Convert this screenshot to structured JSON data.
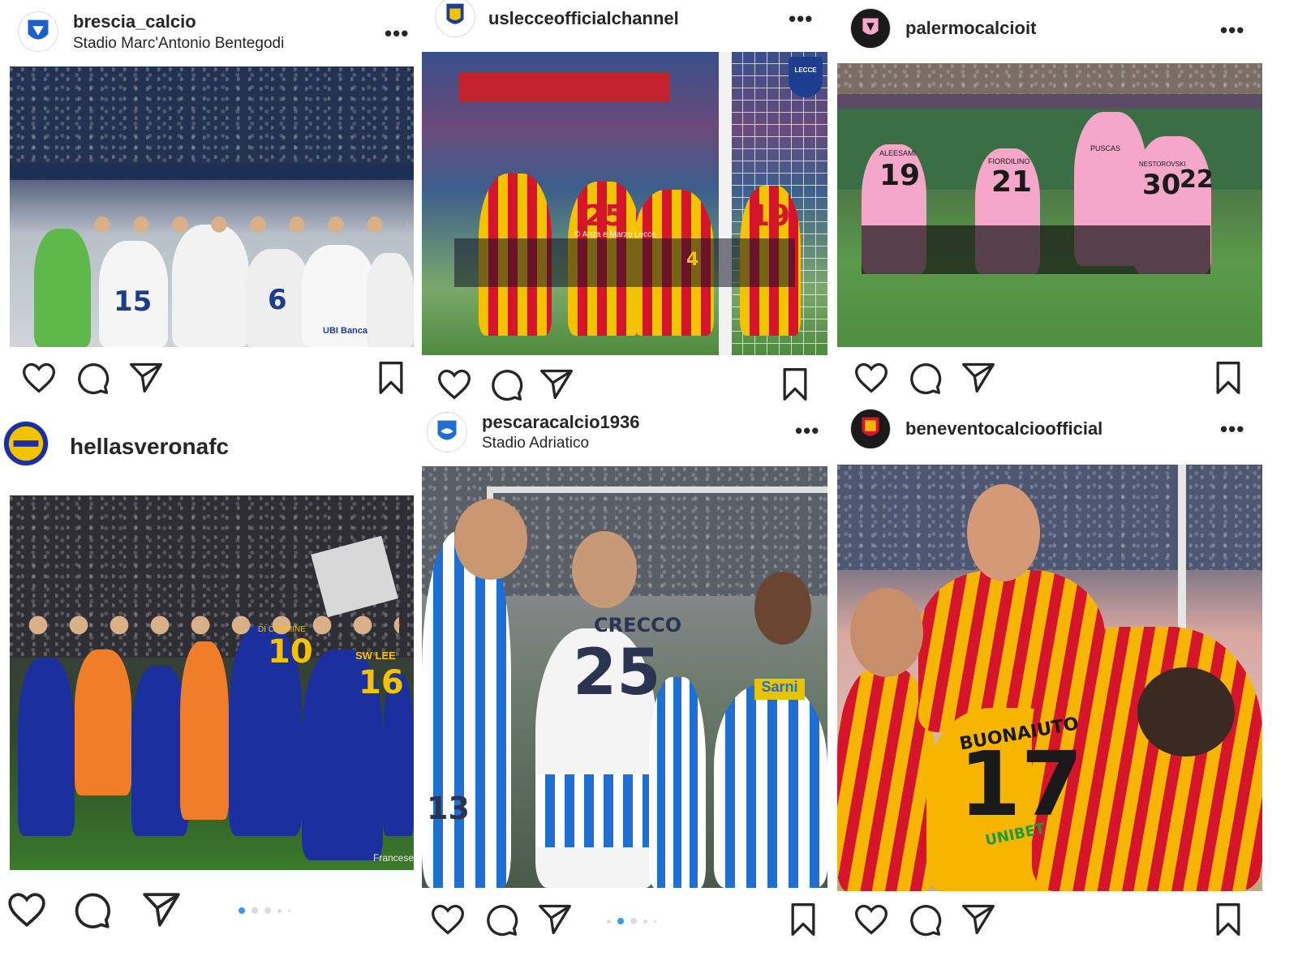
{
  "posts": [
    {
      "username": "brescia_calcio",
      "location": "Stadio Marc'Antonio Bentegodi",
      "more": "•••",
      "photo": {
        "numbers": [
          "15",
          "6"
        ],
        "sponsor": "UBI Banca"
      }
    },
    {
      "username": "uslecceofficialchannel",
      "location": "",
      "more": "•••",
      "photo": {
        "numbers": [
          "25",
          "19",
          "4"
        ],
        "watermark": "© Anza e Marzo Lecce",
        "badge": "LECCE"
      }
    },
    {
      "username": "palermocalcioit",
      "location": "",
      "more": "•••",
      "photo": {
        "numbers": [
          "19",
          "21",
          "30",
          "22"
        ],
        "names": [
          "ALEESAMI",
          "FIORDILINO",
          "PUSCAS",
          "NESTOROVSKI"
        ]
      }
    },
    {
      "username": "hellasveronafc",
      "location": "",
      "more": "",
      "photo": {
        "numbers": [
          "10",
          "16"
        ],
        "names": [
          "DI CARMINE",
          "SW LEE"
        ],
        "watermark": "Francese"
      },
      "carousel": {
        "count": 5,
        "active": 0
      }
    },
    {
      "username": "pescaracalcio1936",
      "location": "Stadio Adriatico",
      "more": "•••",
      "photo": {
        "numbers": [
          "25",
          "13"
        ],
        "names": [
          "CRECCO"
        ],
        "sponsor": "Sarni"
      },
      "carousel": {
        "count": 5,
        "active": 1
      }
    },
    {
      "username": "beneventocalcioofficial",
      "location": "",
      "more": "•••",
      "photo": {
        "numbers": [
          "17"
        ],
        "names": [
          "BUONAIUTO"
        ],
        "sponsor": "UNIBET"
      }
    }
  ],
  "icons": {
    "like": "heart-icon",
    "comment": "comment-icon",
    "share": "send-icon",
    "save": "bookmark-icon"
  },
  "colors": {
    "text": "#262626",
    "carousel_active": "#3897f0",
    "carousel_inactive": "#dbdbdb",
    "brescia_blue": "#1d3d8f",
    "lecce_yellow": "#f4c300",
    "lecce_red": "#d5152a",
    "palermo_pink": "#f4a7c8",
    "verona_blue": "#1b2f9e",
    "pescara_blue": "#1e6fd1",
    "benevento_yellow": "#f7b500"
  }
}
